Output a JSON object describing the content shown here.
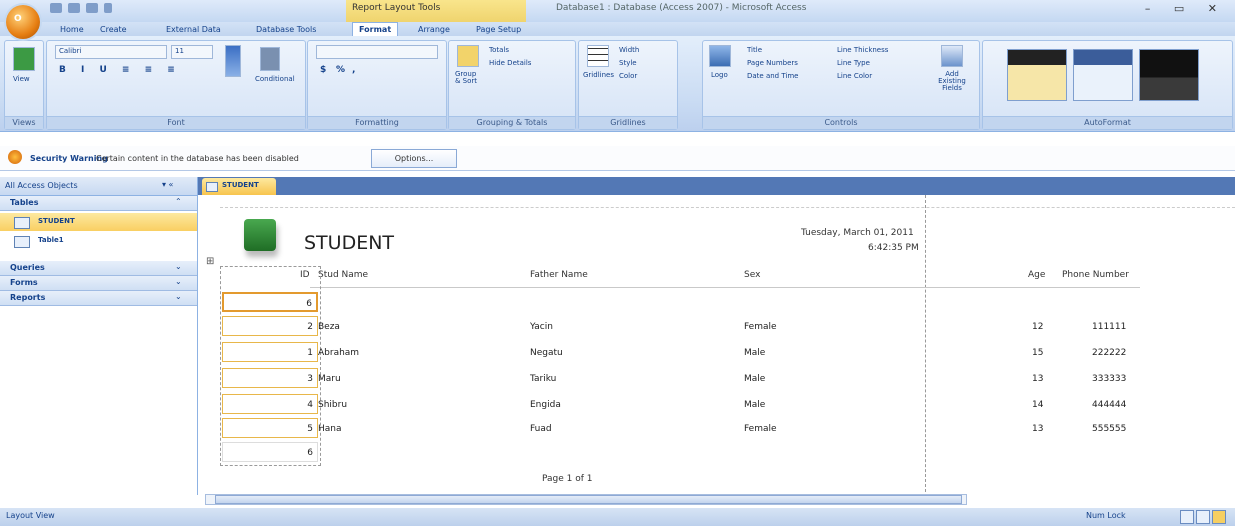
{
  "window": {
    "title": "Database1 : Database (Access 2007) - Microsoft Access",
    "context_tab_group": "Report Layout Tools",
    "controls": "–  ▭  ✕"
  },
  "office_button": {
    "label": "O"
  },
  "tabs": [
    "Home",
    "Create",
    "External Data",
    "Database Tools",
    "Format",
    "Arrange",
    "Page Setup"
  ],
  "active_tab": "Format",
  "ribbon": {
    "groups": {
      "views": {
        "label": "Views",
        "button": "View"
      },
      "font": {
        "label": "Font",
        "font_name": "Calibri",
        "font_size": "11",
        "conditional": "Conditional"
      },
      "formatting": {
        "label": "Formatting",
        "dollar": "$",
        "percent": "%",
        "comma": ","
      },
      "grouping": {
        "label": "Grouping & Totals",
        "group_sort": "Group & Sort",
        "totals": "Totals",
        "hide_details": "Hide Details"
      },
      "gridlines": {
        "label": "Gridlines",
        "gridlines": "Gridlines",
        "width": "Width",
        "style": "Style",
        "color": "Color"
      },
      "controls": {
        "label": "Controls",
        "logo": "Logo",
        "title": "Title",
        "page_numbers": "Page Numbers",
        "date_time": "Date and Time",
        "line_thickness": "Line Thickness",
        "line_type": "Line Type",
        "line_color": "Line Color",
        "add_fields": "Add Existing Fields"
      }
    },
    "autoformat": {
      "label": "AutoFormat"
    }
  },
  "security": {
    "title": "Security Warning",
    "message": "Certain content in the database has been disabled",
    "options_label": "Options..."
  },
  "nav": {
    "header": "All Access Objects",
    "controls": "▾ «",
    "categories": [
      {
        "label": "Tables",
        "chevron": "⌃"
      },
      {
        "label": "Queries",
        "chevron": "⌄"
      },
      {
        "label": "Forms",
        "chevron": "⌄"
      },
      {
        "label": "Reports",
        "chevron": "⌄"
      }
    ],
    "tables": [
      "STUDENT",
      "Table1"
    ]
  },
  "document_tab": "STUDENT",
  "report": {
    "title": "STUDENT",
    "date": "Tuesday, March 01, 2011",
    "time": "6:42:35 PM",
    "columns": [
      "ID",
      "Stud Name",
      "Father Name",
      "Sex",
      "Age",
      "Phone Number"
    ],
    "rows": [
      {
        "id": "6",
        "name": "",
        "father": "",
        "sex": "",
        "age": "",
        "phone": ""
      },
      {
        "id": "2",
        "name": "Beza",
        "father": "Yacin",
        "sex": "Female",
        "age": "12",
        "phone": "111111"
      },
      {
        "id": "1",
        "name": "Abraham",
        "father": "Negatu",
        "sex": "Male",
        "age": "15",
        "phone": "222222"
      },
      {
        "id": "3",
        "name": "Maru",
        "father": "Tariku",
        "sex": "Male",
        "age": "13",
        "phone": "333333"
      },
      {
        "id": "4",
        "name": "Shibru",
        "father": "Engida",
        "sex": "Male",
        "age": "14",
        "phone": "444444"
      },
      {
        "id": "5",
        "name": "Hana",
        "father": "Fuad",
        "sex": "Female",
        "age": "13",
        "phone": "555555"
      }
    ],
    "count": "6",
    "page": "Page 1 of 1"
  },
  "status": {
    "left": "Layout View",
    "right": "Num Lock"
  }
}
